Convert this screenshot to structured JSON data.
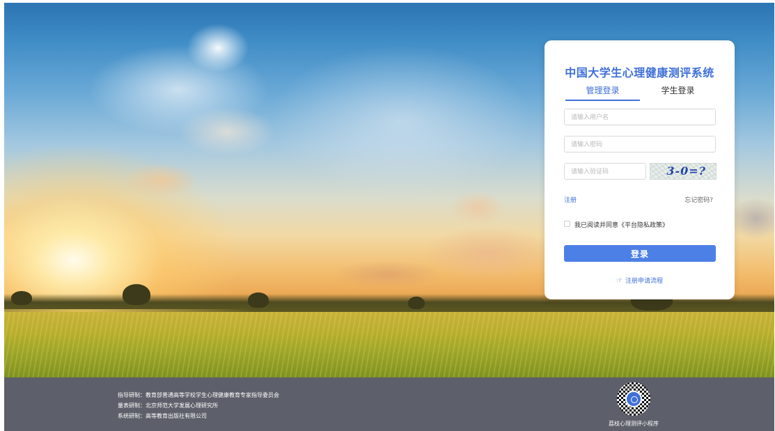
{
  "login": {
    "title": "中国大学生心理健康测评系统",
    "tabs": [
      {
        "label": "管理登录",
        "active": true
      },
      {
        "label": "学生登录",
        "active": false
      }
    ],
    "username_placeholder": "请输入用户名",
    "password_placeholder": "请输入密码",
    "captcha_placeholder": "请输入验证码",
    "captcha_text": "3-0=?",
    "register_label": "注册",
    "forgot_label": "忘记密码?",
    "agree_text": "我已阅读并同意《平台隐私政策》",
    "agree_checked": false,
    "login_button": "登录",
    "flow_link": "注册申请流程",
    "flow_icon": "hand-pointer-icon"
  },
  "footer": {
    "credits": [
      "指导研制：教育部普通高等学校学生心理健康教育专家指导委员会",
      "量表研制：北京师范大学发展心理研究所",
      "系统研制：高等教育出版社有限公司"
    ],
    "qr_label": "荔枝心理测评小程序"
  },
  "colors": {
    "accent": "#3f6fd8",
    "button": "#4d80e6",
    "footer_bg": "#5d606a"
  }
}
